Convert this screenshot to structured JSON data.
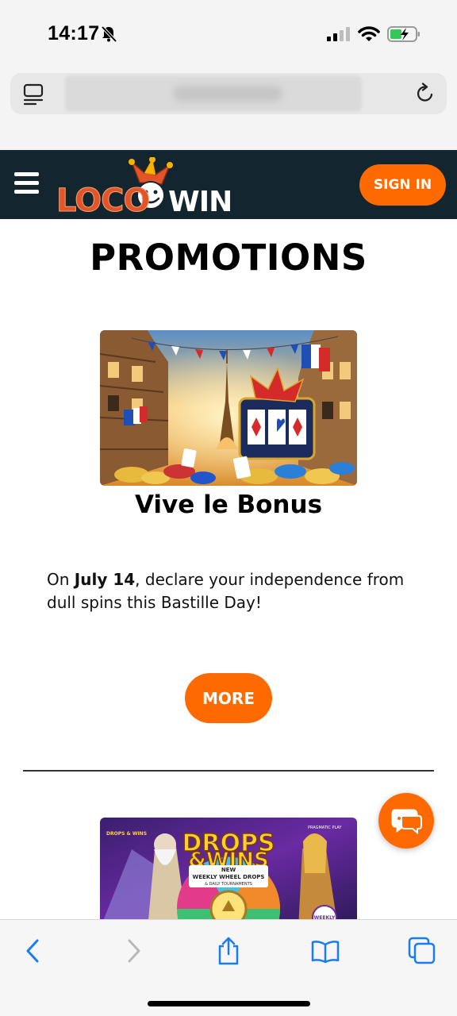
{
  "status_bar": {
    "time": "14:17"
  },
  "browser": {
    "url_text": ""
  },
  "site": {
    "logo_left": "LOCO",
    "logo_right": "WIN",
    "sign_in_label": "SIGN IN"
  },
  "main": {
    "page_title": "PROMOTIONS",
    "promo1": {
      "title": "Vive le Bonus",
      "desc_prefix": "On ",
      "desc_bold": "July 14",
      "desc_suffix": ", declare your independence from dull spins this Bastille Day!",
      "more_label": "MORE"
    },
    "promo2": {
      "image_title_line1": "DROPS",
      "image_title_line2": "&WINS",
      "image_banner_line1": "NEW",
      "image_banner_line2": "WEEKLY WHEEL DROPS",
      "image_banner_line3": "& DAILY TOURNAMENTS",
      "image_corner_left": "DROPS & WINS",
      "image_corner_right": "PRAGMATIC PLAY",
      "image_badge": "WEEKLY"
    }
  },
  "colors": {
    "accent": "#ff6a00",
    "header_bg": "#13252f",
    "ios_blue": "#1a7cf2"
  }
}
